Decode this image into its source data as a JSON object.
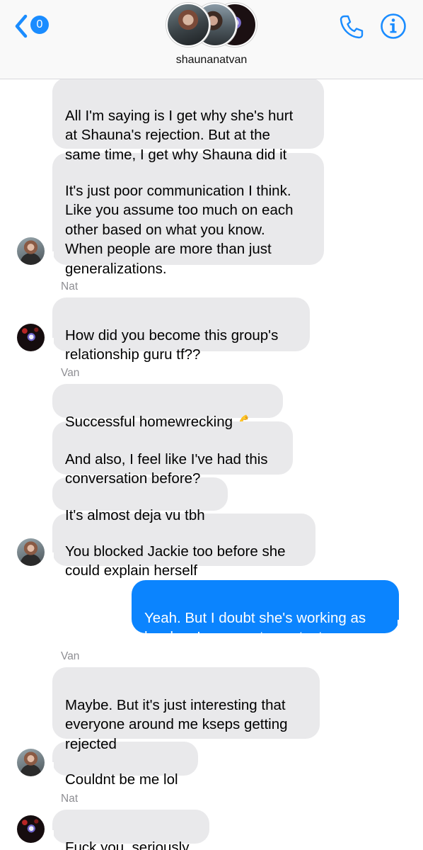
{
  "header": {
    "unread_count": "0",
    "group_name": "shaunanatvan",
    "accent_color": "#1a8cff"
  },
  "messages": [
    {
      "id": "m1",
      "direction": "incoming",
      "text": "All I'm saying is I get why she's hurt\nat Shauna's rejection. But at the\nsame time, I get why Shauna did it"
    },
    {
      "id": "m2",
      "direction": "incoming",
      "text": "It's just poor communication I think.\nLike you assume too much on each\nother based on what you know.\nWhen people are more than just\ngeneralizations."
    },
    {
      "id": "s1",
      "sender": "Nat"
    },
    {
      "id": "m3",
      "direction": "incoming",
      "text": "How did you become this group's\nrelationship guru tf??"
    },
    {
      "id": "s2",
      "sender": "Van"
    },
    {
      "id": "m4",
      "direction": "incoming",
      "text": "Successful homewrecking",
      "emoji": "💪"
    },
    {
      "id": "m5",
      "direction": "incoming",
      "text": "And also, I feel like I've had this\nconversation before?"
    },
    {
      "id": "m6",
      "direction": "incoming",
      "text": "It's almost deja vu tbh"
    },
    {
      "id": "m7",
      "direction": "incoming",
      "text": "You blocked Jackie too before she\ncould explain herself"
    },
    {
      "id": "m8",
      "direction": "outgoing",
      "text": "Yeah. But I doubt she's working as\nhard as I am now to contact me"
    },
    {
      "id": "s3",
      "sender": "Van"
    },
    {
      "id": "m9",
      "direction": "incoming",
      "text": "Maybe. But it's just interesting that\neveryone around me kseps getting\nrejected"
    },
    {
      "id": "m10",
      "direction": "incoming",
      "text": "Couldnt be me lol"
    },
    {
      "id": "s4",
      "sender": "Nat"
    },
    {
      "id": "m11",
      "direction": "incoming",
      "text": "Fuck you, seriously"
    }
  ],
  "colors": {
    "incoming_bubble": "#e9e9eb",
    "outgoing_bubble": "#0b84fe",
    "sender_label": "#8e8e93"
  }
}
